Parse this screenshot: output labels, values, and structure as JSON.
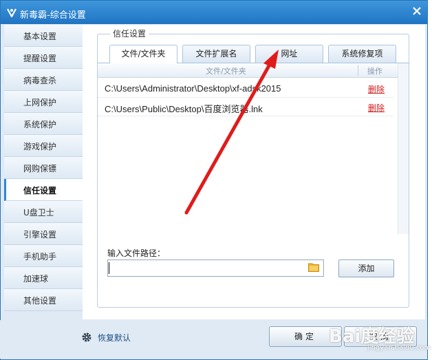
{
  "window": {
    "title": "新毒霸-综合设置"
  },
  "sidebar": {
    "items": [
      {
        "label": "基本设置",
        "active": false
      },
      {
        "label": "提醒设置",
        "active": false
      },
      {
        "label": "病毒查杀",
        "active": false
      },
      {
        "label": "上网保护",
        "active": false
      },
      {
        "label": "系统保护",
        "active": false
      },
      {
        "label": "游戏保护",
        "active": false
      },
      {
        "label": "网购保镖",
        "active": false
      },
      {
        "label": "信任设置",
        "active": true
      },
      {
        "label": "U盘卫士",
        "active": false
      },
      {
        "label": "引擎设置",
        "active": false
      },
      {
        "label": "手机助手",
        "active": false
      },
      {
        "label": "加速球",
        "active": false
      },
      {
        "label": "其他设置",
        "active": false
      }
    ]
  },
  "trust": {
    "group_title": "信任设置",
    "tabs": [
      {
        "label": "文件/文件夹",
        "active": true
      },
      {
        "label": "文件扩展名",
        "active": false
      },
      {
        "label": "网址",
        "active": false
      },
      {
        "label": "系统修复项",
        "active": false
      }
    ],
    "columns": {
      "path": "文件/文件夹",
      "action": "操作"
    },
    "rows": [
      {
        "path": "C:\\Users\\Administrator\\Desktop\\xf-adsk2015",
        "action": "删除"
      },
      {
        "path": "C:\\Users\\Public\\Desktop\\百度浏览器.lnk",
        "action": "删除"
      }
    ],
    "input_label": "输入文件路径：",
    "input_value": "",
    "add_label": "添加"
  },
  "footer": {
    "restore_label": "恢复默认",
    "ok_label": "确定",
    "cancel_label": "取消"
  },
  "watermark": {
    "main": "Bai度经验",
    "sub": "jingyan.baidu.com"
  },
  "colors": {
    "title_bar": "#1f74c2",
    "accent": "#2e86d0",
    "delete_link": "#d11a1a",
    "annotation_arrow": "#e01b1b"
  }
}
